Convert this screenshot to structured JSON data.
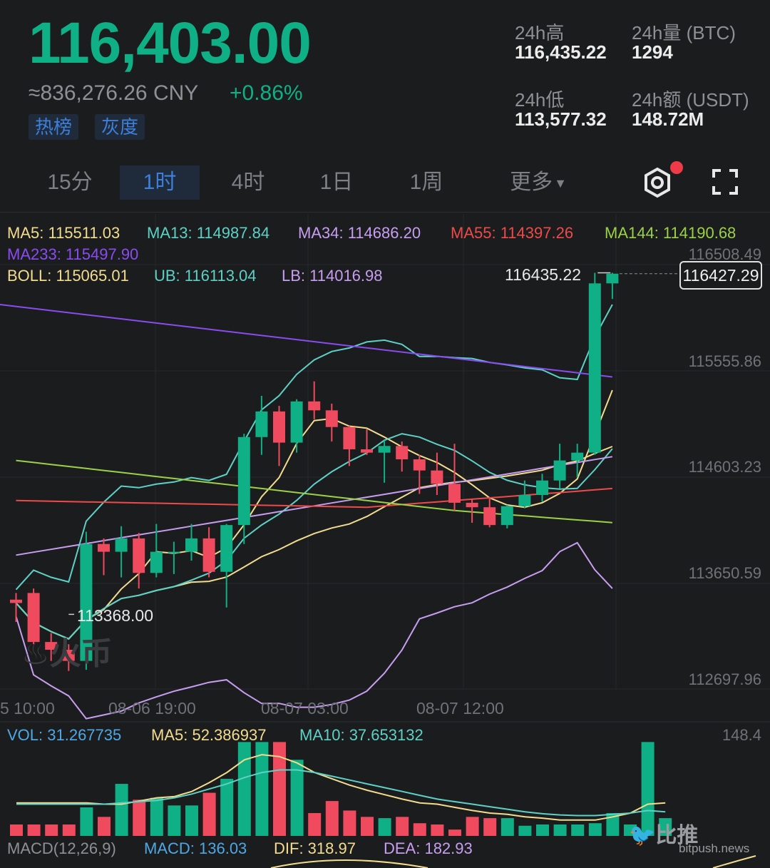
{
  "header": {
    "price": "116,403.00",
    "cny": "≈836,276.26 CNY",
    "change": "+0.86%",
    "tags": [
      "热榜",
      "灰度"
    ]
  },
  "stats": {
    "high_label": "24h高",
    "high_value": "116,435.22",
    "volbtc_label": "24h量 (BTC)",
    "volbtc_value": "1294",
    "low_label": "24h低",
    "low_value": "113,577.32",
    "amount_label": "24h额 (USDT)",
    "amount_value": "148.72M"
  },
  "tabs": [
    "15分",
    "1时",
    "4时",
    "1日",
    "1周",
    "更多"
  ],
  "active_tab": "1时",
  "indicators": {
    "ma5": "MA5: 115511.03",
    "ma13": "MA13: 114987.84",
    "ma34": "MA34: 114686.20",
    "ma55": "MA55: 114397.26",
    "ma144": "MA144: 114190.68",
    "ma233": "MA233: 115497.90",
    "boll": "BOLL: 115065.01",
    "ub": "UB: 116113.04",
    "lb": "LB: 114016.98"
  },
  "volume_indicators": {
    "vol": "VOL: 31.267735",
    "ma5": "MA5: 52.386937",
    "ma10": "MA10: 37.653132",
    "vol_max": "148.4"
  },
  "macd_indicators": {
    "label": "MACD(12,26,9)",
    "macd": "MACD: 136.03",
    "dif": "DIF: 318.97",
    "dea": "DEA: 182.93"
  },
  "watermarks": {
    "exchange": "火币",
    "source": "比推",
    "source_url": "bitpush.news"
  },
  "colors": {
    "up": "#0fb085",
    "down": "#ef4a5d",
    "ma5": "#f3dc8e",
    "ma13": "#5ed1c6",
    "ma34": "#c79ef0",
    "ma55": "#ef4a4a",
    "ma144": "#9bd147",
    "ma233": "#8a4cf0",
    "boll": "#f3dc8e",
    "ub": "#5ed1c6",
    "lb": "#c79ef0",
    "vol": "#4fa8e6"
  },
  "chart_data": {
    "type": "candlestick",
    "y_axis_ticks": [
      116508.49,
      115555.86,
      114603.23,
      113650.59,
      112697.96
    ],
    "x_axis_labels": [
      "5 10:00",
      "08-06 19:00",
      "08-07 03:00",
      "08-07 12:00"
    ],
    "high_marker": "116435.22",
    "low_marker": "113368.00",
    "current_price_tag": "116427.29",
    "candles": [
      {
        "o": 113500,
        "h": 113560,
        "l": 113300,
        "c": 113470
      },
      {
        "o": 113560,
        "h": 113600,
        "l": 113100,
        "c": 113120
      },
      {
        "o": 113120,
        "h": 113200,
        "l": 112950,
        "c": 113050
      },
      {
        "o": 113050,
        "h": 113100,
        "l": 112860,
        "c": 112950
      },
      {
        "o": 112950,
        "h": 114110,
        "l": 112870,
        "c": 114000
      },
      {
        "o": 114000,
        "h": 114050,
        "l": 113720,
        "c": 113930
      },
      {
        "o": 113930,
        "h": 114160,
        "l": 113700,
        "c": 114050
      },
      {
        "o": 114050,
        "h": 114100,
        "l": 113600,
        "c": 113740
      },
      {
        "o": 113740,
        "h": 114180,
        "l": 113700,
        "c": 113930
      },
      {
        "o": 113930,
        "h": 114020,
        "l": 113730,
        "c": 113930
      },
      {
        "o": 113930,
        "h": 114180,
        "l": 113850,
        "c": 114050
      },
      {
        "o": 114050,
        "h": 114150,
        "l": 113700,
        "c": 113750
      },
      {
        "o": 113750,
        "h": 114180,
        "l": 113430,
        "c": 114170
      },
      {
        "o": 114170,
        "h": 114990,
        "l": 114000,
        "c": 114960
      },
      {
        "o": 114960,
        "h": 115330,
        "l": 114800,
        "c": 115190
      },
      {
        "o": 115190,
        "h": 115240,
        "l": 114700,
        "c": 114910
      },
      {
        "o": 114910,
        "h": 115300,
        "l": 114820,
        "c": 115280
      },
      {
        "o": 115280,
        "h": 115460,
        "l": 115120,
        "c": 115200
      },
      {
        "o": 115200,
        "h": 115260,
        "l": 114920,
        "c": 115050
      },
      {
        "o": 115050,
        "h": 115060,
        "l": 114700,
        "c": 114850
      },
      {
        "o": 114850,
        "h": 115030,
        "l": 114800,
        "c": 114820
      },
      {
        "o": 114820,
        "h": 114930,
        "l": 114550,
        "c": 114880
      },
      {
        "o": 114880,
        "h": 114920,
        "l": 114650,
        "c": 114760
      },
      {
        "o": 114760,
        "h": 114800,
        "l": 114450,
        "c": 114660
      },
      {
        "o": 114660,
        "h": 114820,
        "l": 114440,
        "c": 114540
      },
      {
        "o": 114540,
        "h": 114900,
        "l": 114300,
        "c": 114370
      },
      {
        "o": 114370,
        "h": 114400,
        "l": 114190,
        "c": 114330
      },
      {
        "o": 114330,
        "h": 114420,
        "l": 114150,
        "c": 114170
      },
      {
        "o": 114170,
        "h": 114350,
        "l": 114140,
        "c": 114340
      },
      {
        "o": 114340,
        "h": 114570,
        "l": 114320,
        "c": 114440
      },
      {
        "o": 114440,
        "h": 114630,
        "l": 114380,
        "c": 114570
      },
      {
        "o": 114570,
        "h": 114900,
        "l": 114500,
        "c": 114750
      },
      {
        "o": 114750,
        "h": 114900,
        "l": 114600,
        "c": 114820
      },
      {
        "o": 114820,
        "h": 116435,
        "l": 114800,
        "c": 116340
      },
      {
        "o": 116340,
        "h": 116435,
        "l": 116200,
        "c": 116427
      }
    ],
    "volumes": [
      18,
      18,
      18,
      18,
      45,
      30,
      82,
      57,
      60,
      48,
      48,
      68,
      90,
      148,
      148,
      148,
      120,
      36,
      55,
      40,
      30,
      28,
      30,
      20,
      18,
      10,
      30,
      28,
      28,
      16,
      18,
      18,
      18,
      20,
      36,
      18,
      148,
      28
    ],
    "vol_ma5": [
      52,
      52,
      52,
      52,
      52,
      50,
      50,
      55,
      60,
      62,
      70,
      84,
      100,
      120,
      128,
      125,
      115,
      100,
      90,
      80,
      72,
      65,
      58,
      52,
      50,
      45,
      40,
      36,
      34,
      30,
      28,
      25,
      25,
      25,
      30,
      36,
      50,
      52
    ],
    "vol_ma10": [
      50,
      50,
      50,
      50,
      50,
      50,
      52,
      54,
      56,
      60,
      66,
      74,
      82,
      92,
      100,
      104,
      104,
      100,
      94,
      88,
      82,
      76,
      70,
      64,
      58,
      54,
      50,
      46,
      42,
      38,
      35,
      33,
      32,
      32,
      34,
      36,
      40,
      38
    ]
  }
}
